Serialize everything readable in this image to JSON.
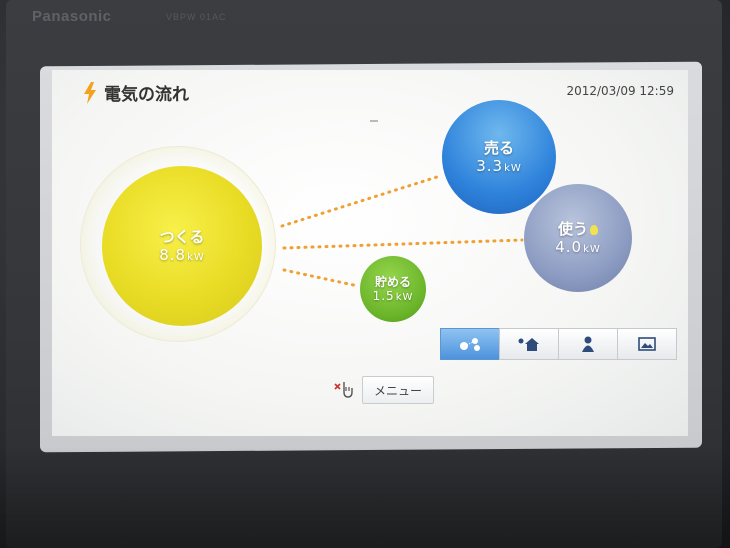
{
  "device": {
    "brand": "Panasonic",
    "model": "VBPW 01AC"
  },
  "header": {
    "title": "電気の流れ",
    "datetime": "2012/03/09 12:59"
  },
  "nodes": {
    "make": {
      "label": "つくる",
      "value": "8.8",
      "unit": "kW"
    },
    "sell": {
      "label": "売る",
      "value": "3.3",
      "unit": "kW"
    },
    "use": {
      "label": "使う",
      "value": "4.0",
      "unit": "kW"
    },
    "store": {
      "label": "貯める",
      "value": "1.5",
      "unit": "kW"
    }
  },
  "tabs": [
    {
      "icon": "energy-flow-icon",
      "active": true
    },
    {
      "icon": "home-icon",
      "active": false
    },
    {
      "icon": "person-icon",
      "active": false
    },
    {
      "icon": "picture-icon",
      "active": false
    }
  ],
  "menu": {
    "label": "メニュー"
  },
  "colors": {
    "make": "#e9dc25",
    "sell": "#2f83db",
    "use": "#8d9cc2",
    "store": "#6bb52a",
    "flow": "#f0a030"
  }
}
